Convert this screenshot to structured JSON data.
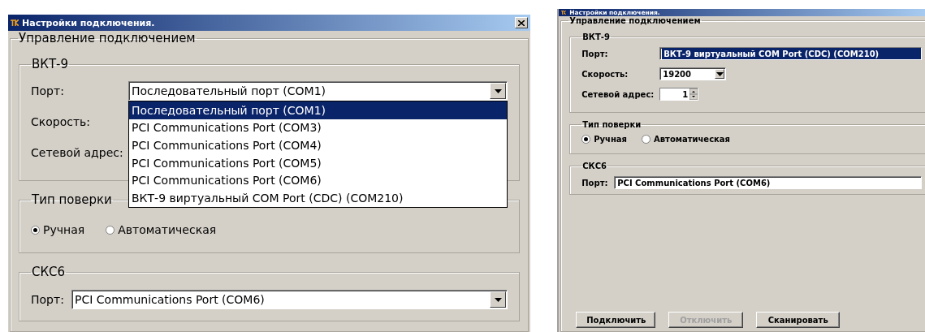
{
  "panels": [
    {
      "title": "Настройки подключения.",
      "connection_group": "Управление подключением",
      "device_group": {
        "title": "ВКТ-9",
        "port": {
          "label": "Порт:",
          "value": "Последовательный порт (COM1)",
          "highlighted": false,
          "options": [
            {
              "label": "Последовательный порт (COM1)",
              "selected": true
            },
            {
              "label": "PCI Communications Port (COM3)",
              "selected": false
            },
            {
              "label": "PCI Communications Port (COM4)",
              "selected": false
            },
            {
              "label": "PCI Communications Port (COM5)",
              "selected": false
            },
            {
              "label": "PCI Communications Port (COM6)",
              "selected": false
            },
            {
              "label": "ВКТ-9 виртуальный COM Port (CDC) (COM210)",
              "selected": false
            }
          ]
        },
        "speed": {
          "label": "Скорость:"
        },
        "address": {
          "label": "Сетевой адрес:"
        }
      },
      "verification_group": {
        "title": "Тип поверки",
        "options": [
          {
            "label": "Ручная",
            "selected": true
          },
          {
            "label": "Автоматическая",
            "selected": false
          }
        ]
      },
      "sks_group": {
        "title": "СКС6",
        "port": {
          "label": "Порт:",
          "value": "PCI Communications Port (COM6)"
        }
      }
    },
    {
      "title": "Настройки подключения.",
      "connection_group": "Управление подключением",
      "device_group": {
        "title": "ВКТ-9",
        "port": {
          "label": "Порт:",
          "value": "ВКТ-9 виртуальный COM Port (CDC) (COM210)",
          "highlighted": true
        },
        "speed": {
          "label": "Скорость:",
          "value": "19200"
        },
        "address": {
          "label": "Сетевой адрес:",
          "value": "1"
        }
      },
      "verification_group": {
        "title": "Тип поверки",
        "options": [
          {
            "label": "Ручная",
            "selected": true
          },
          {
            "label": "Автоматическая",
            "selected": false
          }
        ]
      },
      "sks_group": {
        "title": "СКС6",
        "port": {
          "label": "Порт:",
          "value": "PCI Communications Port (COM6)"
        }
      },
      "buttons": [
        {
          "label": "Подключить",
          "disabled": false
        },
        {
          "label": "Отключить",
          "disabled": true
        },
        {
          "label": "Сканировать",
          "disabled": false
        }
      ]
    }
  ]
}
